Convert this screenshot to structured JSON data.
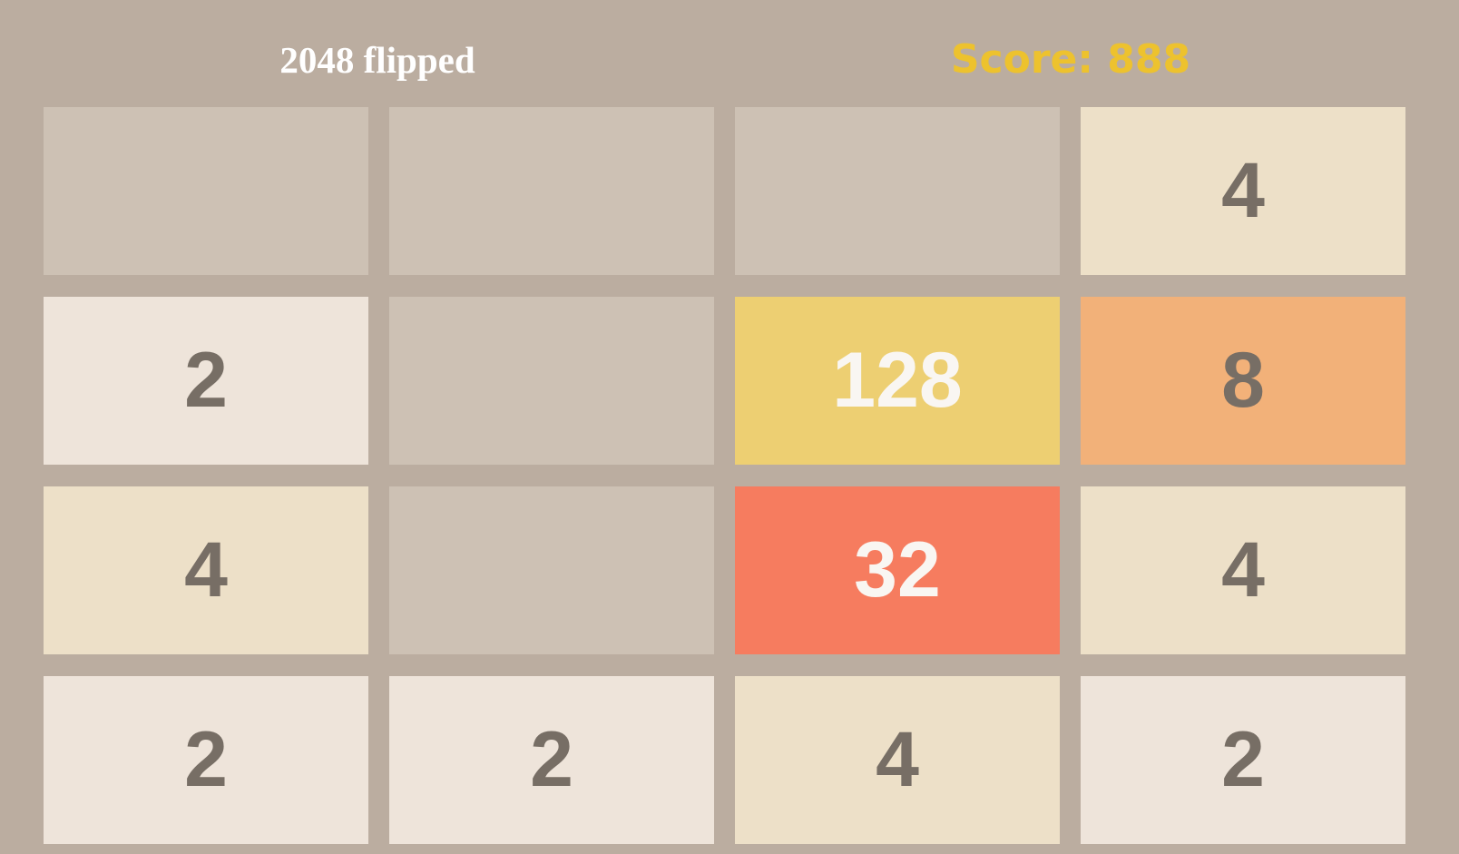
{
  "header": {
    "title": "2048 flipped",
    "score": "Score: 888"
  },
  "board": {
    "rows": [
      [
        "",
        "",
        "",
        "4"
      ],
      [
        "2",
        "",
        "128",
        "8"
      ],
      [
        "4",
        "",
        "32",
        "4"
      ],
      [
        "2",
        "2",
        "4",
        "2"
      ]
    ]
  },
  "colors": {
    "background": "#bbada0",
    "empty": "#cdc1b4",
    "tile_2": "#eee4da",
    "tile_4": "#ede0c8",
    "tile_8": "#f2b179",
    "tile_32": "#f67c5f",
    "tile_128": "#edcf72",
    "score_text": "#edc22e"
  }
}
